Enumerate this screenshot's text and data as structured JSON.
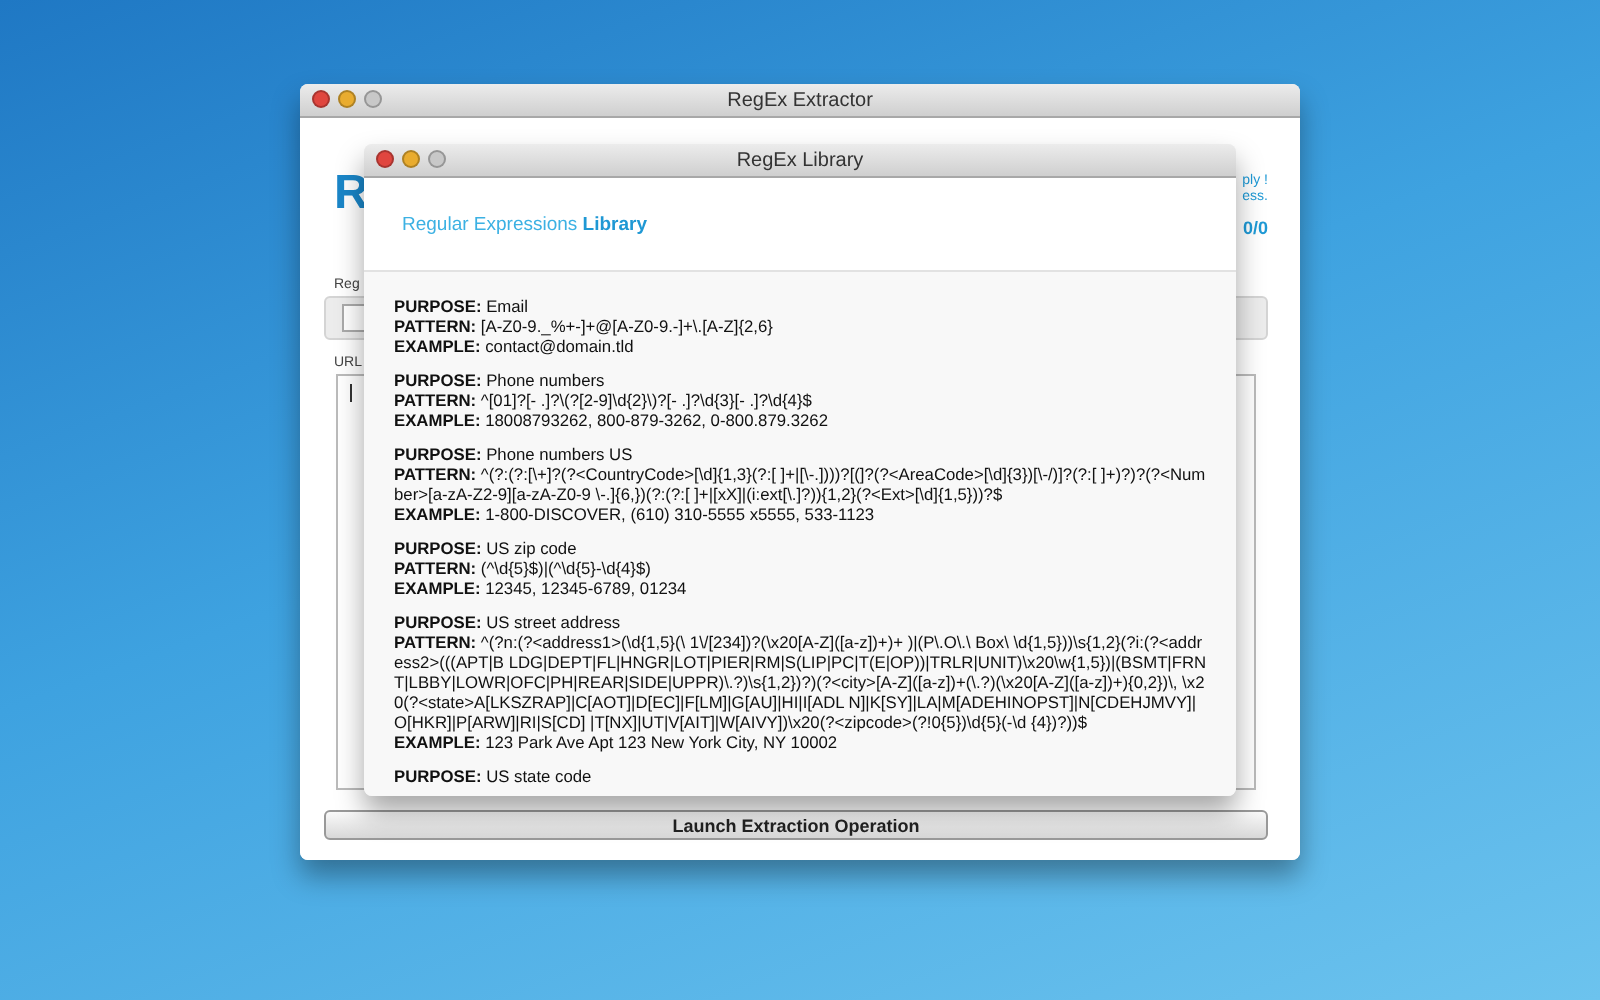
{
  "main_window": {
    "title": "RegEx Extractor",
    "logo": "R",
    "header_right": [
      "ply !",
      "ess.",
      "0/0"
    ],
    "labels": [
      "Reg",
      "URL"
    ],
    "launch_button": "Launch Extraction Operation"
  },
  "library_window": {
    "title": "RegEx Library",
    "heading": "Regular Expressions **Library**",
    "entries": [
      [
        "**PURPOSE:** Email",
        "**PATTERN:** [A-Z0-9._%+-]+@[A-Z0-9.-]+\\.[A-Z]{2,6}",
        "**EXAMPLE:** contact@domain.tld"
      ],
      [
        "**PURPOSE:** Phone numbers",
        "**PATTERN:** ^[01]?[- .]?\\(?[2-9]\\d{2}\\)?[- .]?\\d{3}[- .]?\\d{4}$",
        "**EXAMPLE:** 18008793262, 800-879-3262, 0-800.879.3262"
      ],
      [
        "**PURPOSE:** Phone numbers US",
        "**PATTERN:** ^(?:(?:[\\+]?(?<CountryCode>[\\d]{1,3}(?:[ ]+|[\\-.])))?[(]?(?<AreaCode>[\\d]{3})[\\-/)]?(?:[ ]+)?)?(?<Number>[a-zA-Z2-9][a-zA-Z0-9 \\-.]{6,})(?:(?:[ ]+|[xX]|(i:ext[\\.]?)){1,2}(?<Ext>[\\d]{1,5}))?$",
        "**EXAMPLE:** 1-800-DISCOVER, (610) 310-5555 x5555, 533-1123"
      ],
      [
        "**PURPOSE:** US zip code",
        "**PATTERN:** (^\\d{5}$)|(^\\d{5}-\\d{4}$)",
        "**EXAMPLE:** 12345, 12345-6789, 01234"
      ],
      [
        "**PURPOSE:** US street address",
        "**PATTERN:** ^(?n:(?<address1>(\\d{1,5}(\\ 1\\/[234])?(\\x20[A-Z]([a-z])+)+ )|(P\\.O\\.\\ Box\\ \\d{1,5}))\\s{1,2}(?i:(?<address2>(((APT|B LDG|DEPT|FL|HNGR|LOT|PIER|RM|S(LIP|PC|T(E|OP))|TRLR|UNIT)\\x20\\w{1,5})|(BSMT|FRNT|LBBY|LOWR|OFC|PH|REAR|SIDE|UPPR)\\.?)\\s{1,2})?)(?<city>[A-Z]([a-z])+(\\.?)(\\x20[A-Z]([a-z])+){0,2})\\, \\x20(?<state>A[LKSZRAP]|C[AOT]|D[EC]|F[LM]|G[AU]|HI|I[ADL N]|K[SY]|LA|M[ADEHINOPST]|N[CDEHJMVY]|O[HKR]|P[ARW]|RI|S[CD] |T[NX]|UT|V[AIT]|W[AIVY])\\x20(?<zipcode>(?!0{5})\\d{5}(-\\d {4})?))$",
        "**EXAMPLE:** 123 Park Ave Apt 123 New York City, NY 10002"
      ],
      [
        "**PURPOSE:** US state code"
      ]
    ]
  }
}
